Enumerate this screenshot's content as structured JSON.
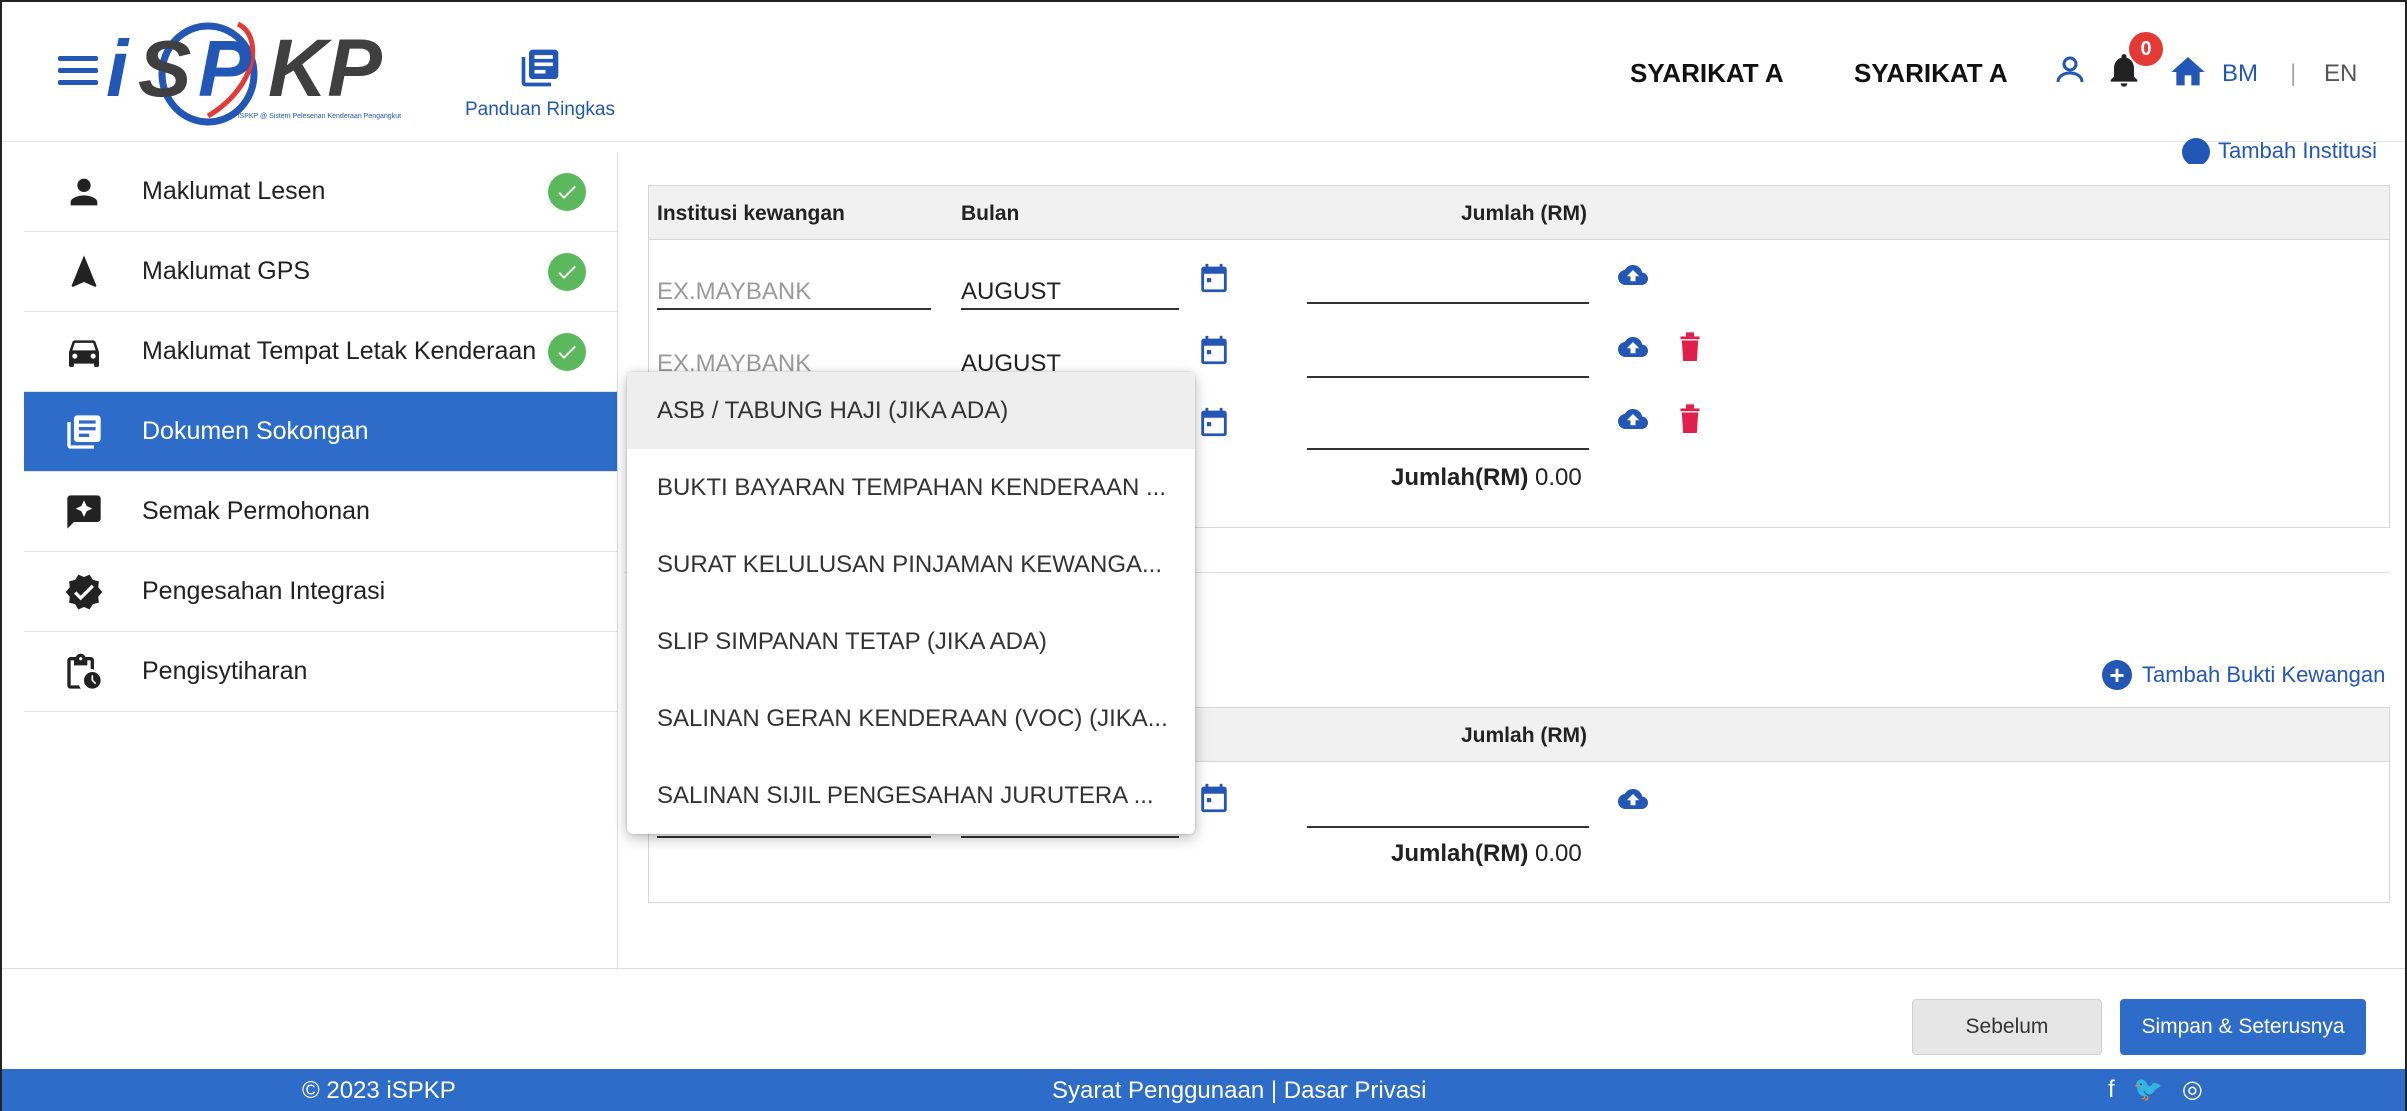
{
  "header": {
    "logo_text": "iSPKP",
    "logo_tagline": "iSPKP @ Sistem Pelesenan Kenderaan Pengangkut",
    "guide_label": "Panduan Ringkas",
    "company_1": "SYARIKAT A",
    "company_2": "SYARIKAT A",
    "notification_count": "0",
    "lang_bm": "BM",
    "lang_sep": "|",
    "lang_en": "EN"
  },
  "sidebar": {
    "items": [
      {
        "label": "Maklumat Lesen",
        "icon": "person-icon",
        "completed": true
      },
      {
        "label": "Maklumat GPS",
        "icon": "navigation-icon",
        "completed": true
      },
      {
        "label": "Maklumat Tempat Letak Kenderaan",
        "icon": "car-icon",
        "completed": true
      },
      {
        "label": "Dokumen Sokongan",
        "icon": "document-list-icon",
        "active": true
      },
      {
        "label": "Semak Permohonan",
        "icon": "review-icon"
      },
      {
        "label": "Pengesahan Integrasi",
        "icon": "verified-icon"
      },
      {
        "label": "Pengisytiharan",
        "icon": "declaration-icon"
      }
    ]
  },
  "main": {
    "top_link": "Tambah Institusi",
    "table1": {
      "headers": [
        "Institusi kewangan",
        "Bulan",
        "Jumlah (RM)"
      ],
      "rows": [
        {
          "institution_placeholder": "EX.MAYBANK",
          "month": "AUGUST",
          "amount": ""
        },
        {
          "institution_placeholder": "EX.MAYBANK",
          "month": "AUGUST",
          "amount": ""
        },
        {
          "institution_placeholder": "",
          "month": "",
          "amount": ""
        }
      ],
      "total_label": "Jumlah(RM)",
      "total_value": "0.00"
    },
    "add_proof_link": "Tambah Bukti Kewangan",
    "table2": {
      "header_amount": "Jumlah (RM)",
      "total_label": "Jumlah(RM)",
      "total_value": "0.00"
    }
  },
  "dropdown": {
    "options": [
      "ASB / TABUNG HAJI (JIKA ADA)",
      "BUKTI BAYARAN TEMPAHAN KENDERAAN ...",
      "SURAT KELULUSAN PINJAMAN KEWANGA...",
      "SLIP SIMPANAN TETAP (JIKA ADA)",
      "SALINAN GERAN KENDERAAN (VOC) (JIKA...",
      "SALINAN SIJIL PENGESAHAN JURUTERA ..."
    ],
    "hovered_index": 0
  },
  "actions": {
    "prev_label": "Sebelum",
    "next_label": "Simpan & Seterusnya"
  },
  "footer": {
    "copyright": "© 2023 iSPKP",
    "links": "Syarat Penggunaan | Dasar Privasi",
    "social": "f 🐦 ◎"
  },
  "colors": {
    "primary": "#2e6cc9",
    "link": "#2357b5",
    "success": "#5cb85c",
    "danger": "#e53935"
  }
}
